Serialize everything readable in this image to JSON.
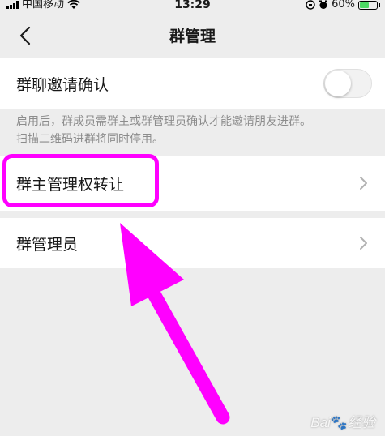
{
  "status_bar": {
    "carrier": "中国移动",
    "time": "13:29",
    "battery": "60%",
    "battery_level": 0.6
  },
  "nav": {
    "title": "群管理",
    "back_icon": "chevron-left-icon"
  },
  "invite_confirm": {
    "label": "群聊邀请确认",
    "toggle_on": false
  },
  "description": {
    "line1": "启用后，群成员需群主或群管理员确认才能邀请朋友进群。",
    "line2": "扫描二维码进群将同时停用。"
  },
  "rows": {
    "owner_transfer": "群主管理权转让",
    "admins": "群管理员"
  },
  "annotation": {
    "color": "#ff00ff"
  },
  "watermark": "Baidu经验"
}
